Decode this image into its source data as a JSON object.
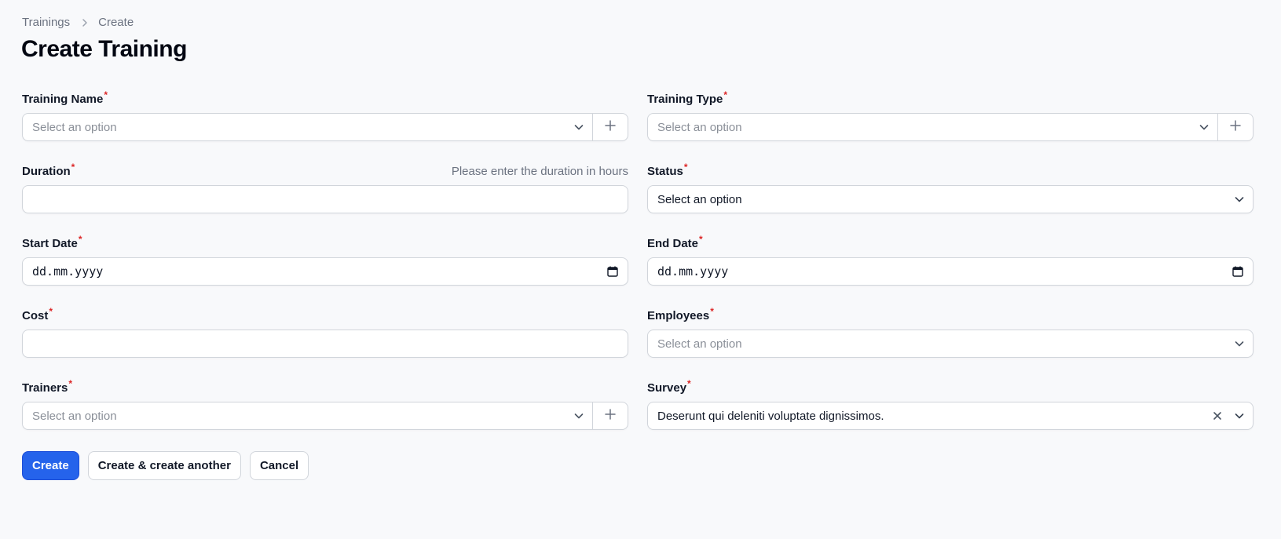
{
  "breadcrumb": {
    "items": [
      "Trainings",
      "Create"
    ]
  },
  "page": {
    "title": "Create Training"
  },
  "fields": {
    "training_name": {
      "label": "Training Name",
      "required": "*",
      "placeholder": "Select an option"
    },
    "training_type": {
      "label": "Training Type",
      "required": "*",
      "placeholder": "Select an option"
    },
    "duration": {
      "label": "Duration",
      "required": "*",
      "hint": "Please enter the duration in hours",
      "value": ""
    },
    "status": {
      "label": "Status",
      "required": "*",
      "value": "Select an option"
    },
    "start_date": {
      "label": "Start Date",
      "required": "*",
      "value": "dd.mm.yyyy"
    },
    "end_date": {
      "label": "End Date",
      "required": "*",
      "value": "dd.mm.yyyy"
    },
    "cost": {
      "label": "Cost",
      "required": "*",
      "value": ""
    },
    "employees": {
      "label": "Employees",
      "required": "*",
      "placeholder": "Select an option"
    },
    "trainers": {
      "label": "Trainers",
      "required": "*",
      "placeholder": "Select an option"
    },
    "survey": {
      "label": "Survey",
      "required": "*",
      "value": "Deserunt qui deleniti voluptate dignissimos."
    }
  },
  "actions": {
    "create": "Create",
    "create_another": "Create & create another",
    "cancel": "Cancel"
  },
  "icons": {
    "breadcrumb_separator": "chevron-right-icon",
    "select_indicator": "chevron-down-icon",
    "add": "plus-icon",
    "calendar": "calendar-icon",
    "clear": "close-icon"
  },
  "colors": {
    "primary": "#2563eb",
    "required": "#dc2626",
    "background": "#f8f9fb"
  }
}
